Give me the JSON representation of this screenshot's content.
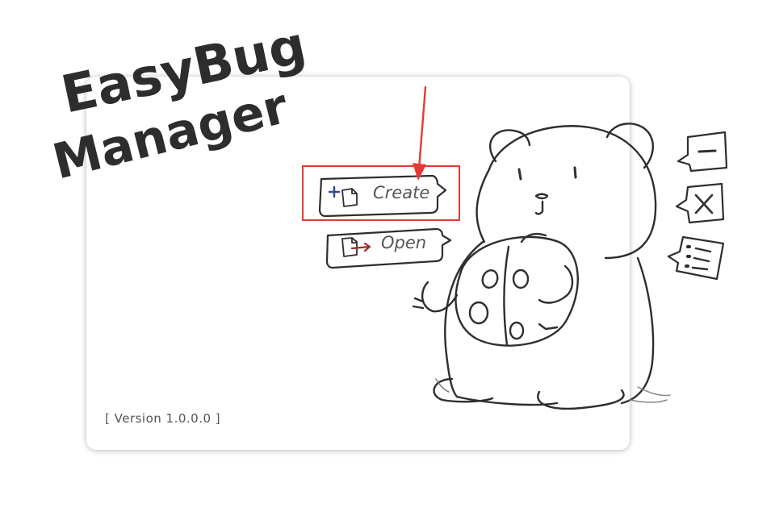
{
  "app": {
    "title_line1": "EasyBug",
    "title_line2": "Manager"
  },
  "menu": {
    "create_label": "Create",
    "open_label": "Open"
  },
  "window_controls": {
    "minimize_icon": "minimize-icon",
    "close_icon": "close-icon",
    "list_icon": "list-icon"
  },
  "footer": {
    "version": "[ Version 1.0.0.0 ]"
  },
  "annotation": {
    "highlight_color": "#e53935"
  }
}
